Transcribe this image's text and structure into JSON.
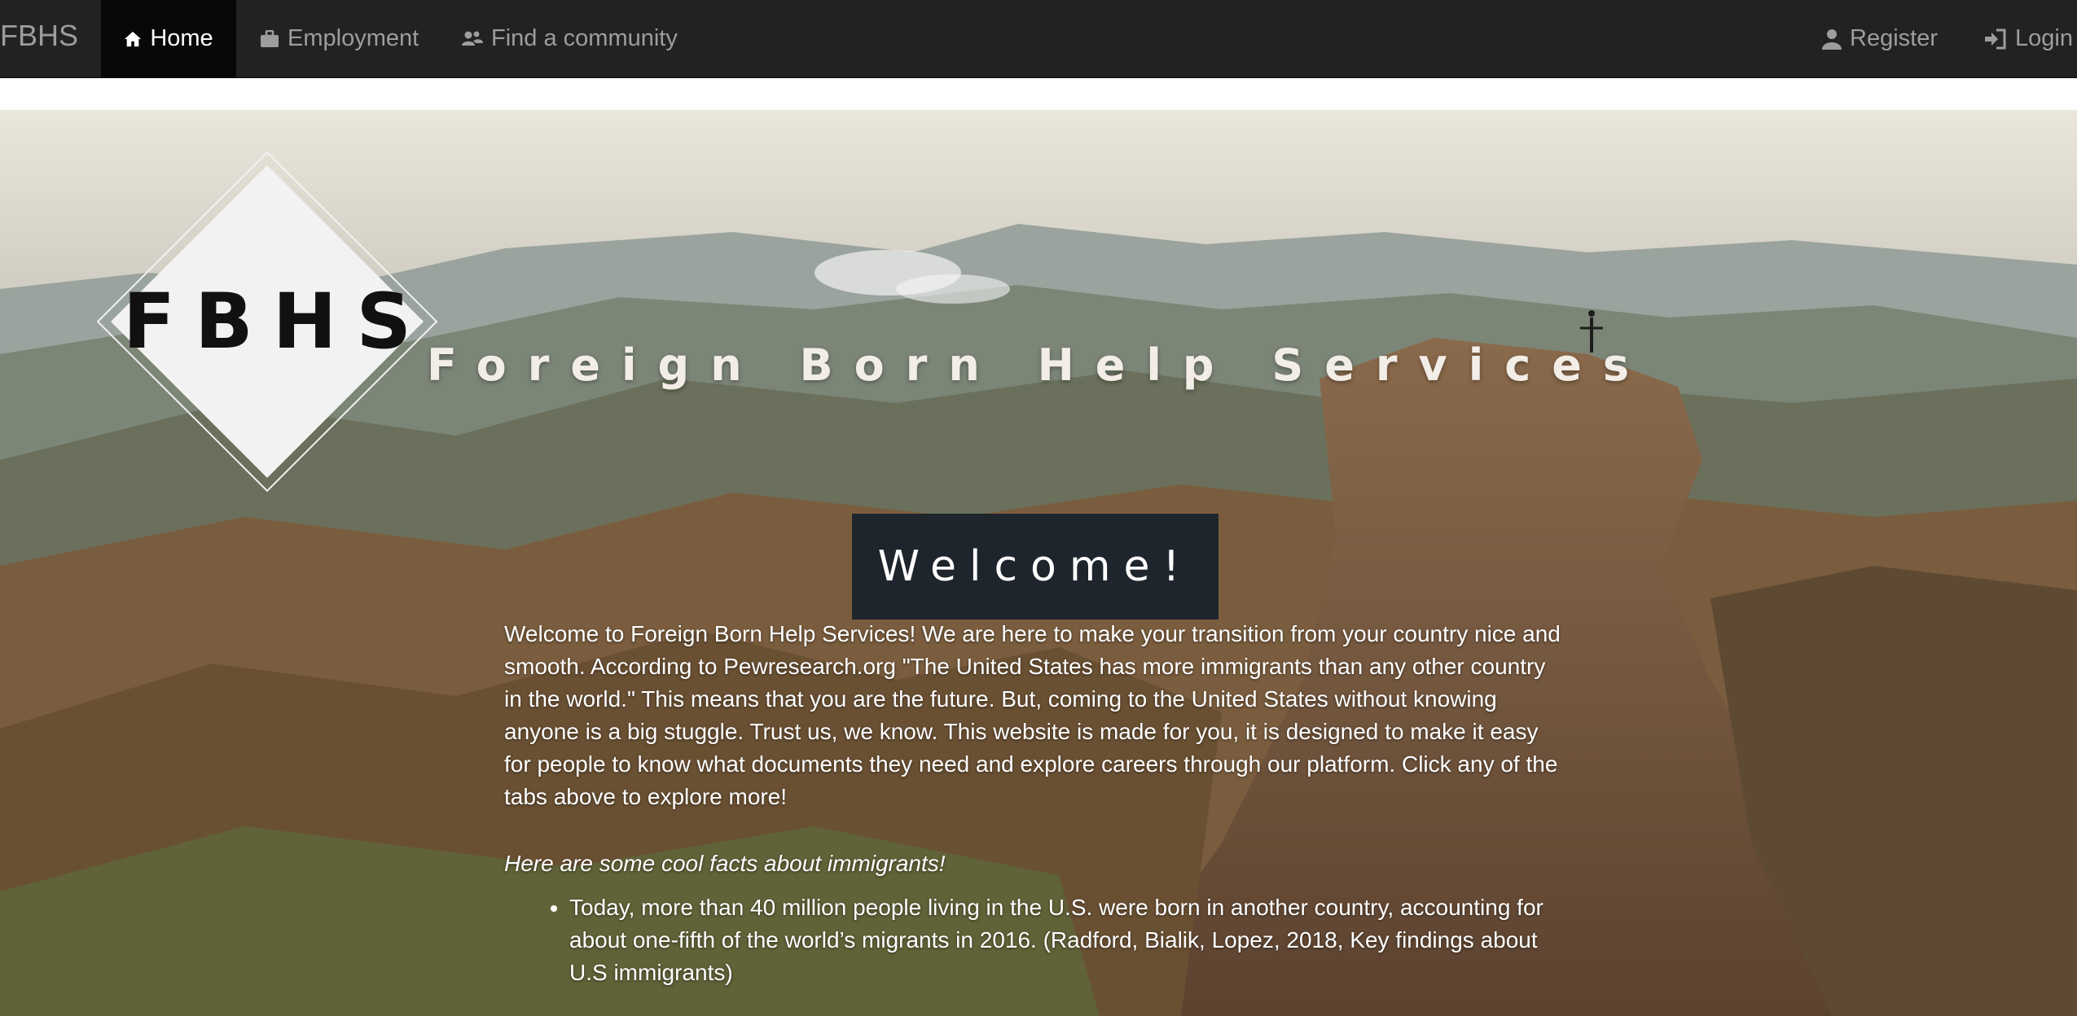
{
  "nav": {
    "brand": "FBHS",
    "items": [
      {
        "label": "Home",
        "icon": "home-icon",
        "active": true
      },
      {
        "label": "Employment",
        "icon": "briefcase-icon",
        "active": false
      },
      {
        "label": "Find a community",
        "icon": "community-icon",
        "active": false
      }
    ],
    "right": [
      {
        "label": "Register",
        "icon": "user-icon"
      },
      {
        "label": "Login",
        "icon": "login-icon"
      }
    ]
  },
  "hero": {
    "logo_text": "FBHS",
    "title": "Foreign Born Help Services",
    "welcome": "Welcome!",
    "intro": "Welcome to Foreign Born Help Services! We are here to make your transition from your country nice and smooth. According to Pewresearch.org \"The United States has more immigrants than any other country in the world.\" This means that you are the future. But, coming to the United States without knowing anyone is a big stuggle. Trust us, we know. This website is made for you, it is designed to make it easy for people to know what documents they need and explore careers through our platform. Click any of the tabs above to explore more!",
    "facts_title": "Here are some cool facts about immigrants!",
    "facts": [
      "Today, more than 40 million people living in the U.S. were born in another country, accounting for about one-fifth of the world’s migrants in 2016. (Radford, Bialik, Lopez, 2018, Key findings about U.S immigrants)"
    ]
  },
  "colors": {
    "navbar_bg": "#222222",
    "nav_active_bg": "#080808",
    "nav_text": "#9d9d9d",
    "welcome_box_bg": "#1e252c"
  }
}
